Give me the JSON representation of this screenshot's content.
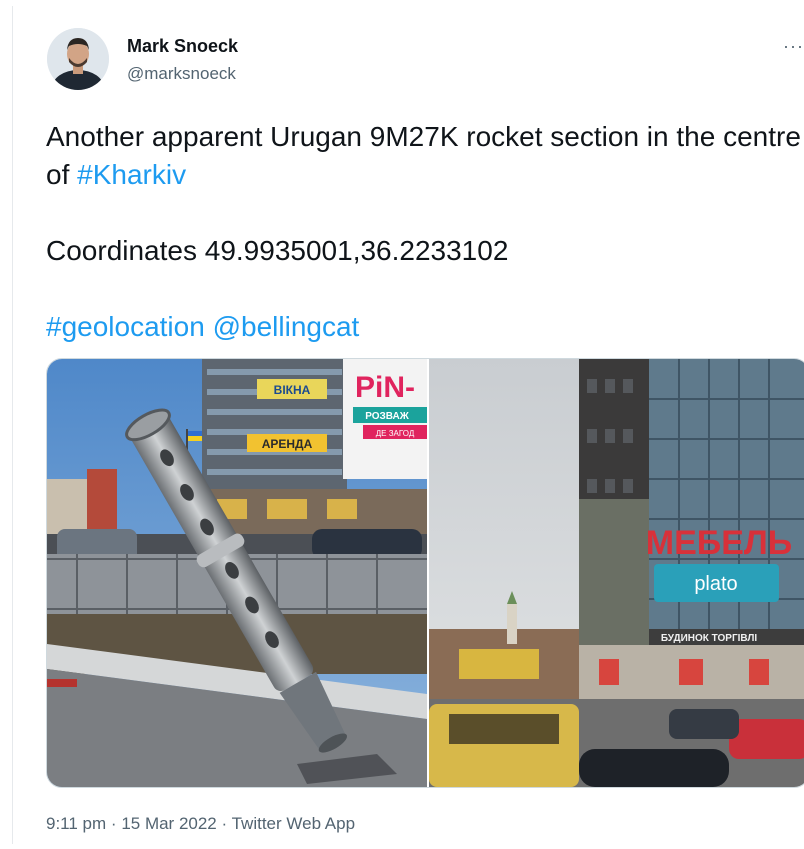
{
  "author": {
    "name": "Mark Snoeck",
    "handle": "@marksnoeck"
  },
  "more_icon": "more-horizontal-icon",
  "tweet": {
    "line1_prefix": "Another apparent Urugan 9M27K rocket section in the centre of ",
    "hashtag_kharkiv": "#Kharkiv",
    "coordinates": "Coordinates 49.9935001,36.2233102",
    "hashtag_geolocation": "#geolocation",
    "mention": "@bellingcat"
  },
  "photos": {
    "left": {
      "sign_pin": "PiN-",
      "sign_rozvazh": "РОЗВАЖ",
      "sign_dlya": "ДЕ ЗАГОД",
      "sign_vikna": "ВІКНА",
      "sign_arenda": "АРЕНДА"
    },
    "right": {
      "sign_mebel": "МЕБЕЛЬ",
      "sign_plato": "plato",
      "sign_budynok": "БУДИНОК  ТОРГІВЛІ"
    }
  },
  "footer": {
    "time": "9:11 pm",
    "separator": "·",
    "date": "15 Mar 2022",
    "app": "Twitter Web App"
  },
  "colors": {
    "link": "#1d9bf0",
    "secondary_text": "#536471",
    "primary_text": "#0f1419"
  }
}
